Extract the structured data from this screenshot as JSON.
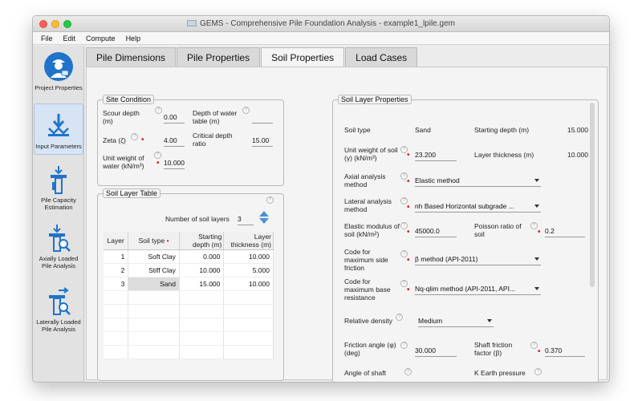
{
  "window": {
    "title": "GEMS - Comprehensive Pile Foundation Analysis - example1_lpile.gem"
  },
  "menu": [
    "File",
    "Edit",
    "Compute",
    "Help"
  ],
  "sidebar": {
    "items": [
      {
        "label": "Project Properties",
        "icon": "engineer-icon"
      },
      {
        "label": "Input Parameters",
        "icon": "download-pile-icon"
      },
      {
        "label": "Pile Capacity Estimation",
        "icon": "pile-download-icon"
      },
      {
        "label": "Axially Loaded Pile Analysis",
        "icon": "pile-search-icon"
      },
      {
        "label": "Laterally Loaded Pile Analysis",
        "icon": "lateral-pile-icon"
      }
    ]
  },
  "tabs": [
    {
      "label": "Pile Dimensions"
    },
    {
      "label": "Pile Properties"
    },
    {
      "label": "Soil Properties"
    },
    {
      "label": "Load Cases"
    }
  ],
  "site": {
    "legend": "Site Condition",
    "scour_label": "Scour depth (m)",
    "scour_value": "0.00",
    "water_table_label": "Depth of water table (m)",
    "water_table_value": "",
    "zeta_label": "Zeta (ζ)",
    "zeta_value": "4.00",
    "critical_label": "Critical depth ratio",
    "critical_value": "15.00",
    "unit_weight_label": "Unit weight of water (kN/m³)",
    "unit_weight_value": "10.000"
  },
  "layer_table": {
    "legend": "Soil Layer Table",
    "count_label": "Number of soil layers",
    "count_value": "3",
    "headers": [
      "Layer",
      "Soil type",
      "Starting depth (m)",
      "Layer thickness (m)"
    ],
    "rows": [
      [
        "1",
        "Soft Clay",
        "0.000",
        "10.000"
      ],
      [
        "2",
        "Stiff Clay",
        "10.000",
        "5.000"
      ],
      [
        "3",
        "Sand",
        "15.000",
        "10.000"
      ]
    ]
  },
  "layer_props": {
    "legend": "Soil Layer Properties",
    "soil_type_label": "Soil type",
    "soil_type_value": "Sand",
    "start_depth_label": "Starting depth (m)",
    "start_depth_value": "15.000",
    "unit_weight_label": "Unit weight of soil (γ) (kN/m³)",
    "unit_weight_value": "23.200",
    "thickness_label": "Layer thickness (m)",
    "thickness_value": "10.000",
    "axial_label": "Axial analysis method",
    "axial_value": "Elastic method",
    "lateral_label": "Lateral analysis method",
    "lateral_value": "nh Based Horizontal subgrade ...",
    "elastic_label": "Elastic modulus of soil (kN/m²)",
    "elastic_value": "45000.0",
    "poisson_label": "Poisson ratio of soil",
    "poisson_value": "0.2",
    "side_friction_label": "Code for maximum side friction",
    "side_friction_value": "β method (API-2011)",
    "base_resistance_label": "Code for maximum base resistance",
    "base_resistance_value": "Nq-qlim method (API-2011, API...",
    "density_label": "Relative density",
    "density_value": "Medium",
    "friction_label": "Friction angle (φ) (deg)",
    "friction_value": "30.000",
    "shaft_label": "Shaft friction factor (β)",
    "shaft_value": "0.370",
    "angle_shaft_label": "Angle of shaft",
    "k_earth_label": "K Earth pressure"
  },
  "colors": {
    "required": "#d9242d",
    "active_nav": "#d7e4f3",
    "spinner": "#4a8fd8"
  }
}
